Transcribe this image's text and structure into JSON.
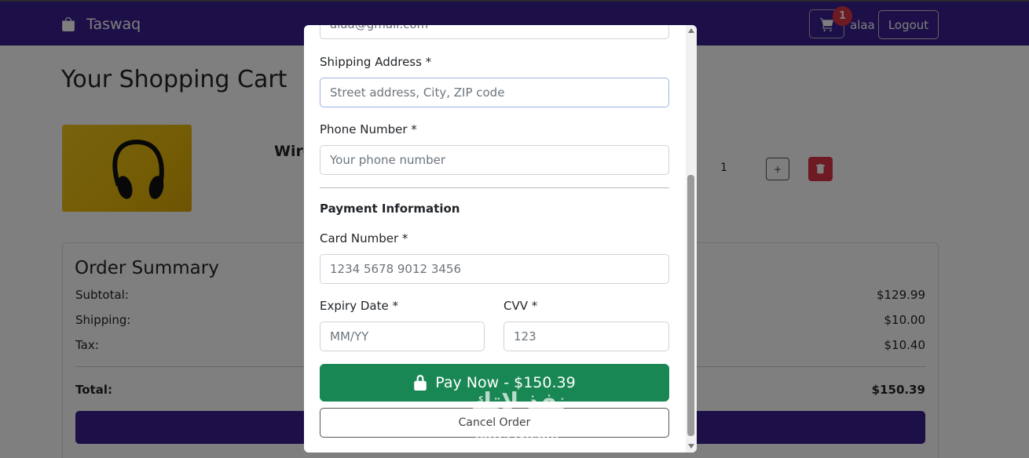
{
  "navbar": {
    "brand": "Taswaq",
    "cart_count": "1",
    "username": "alaa",
    "logout_label": "Logout"
  },
  "cart": {
    "title": "Your Shopping Cart",
    "item": {
      "name": "Wire",
      "quantity": "1",
      "plus_label": "+"
    }
  },
  "summary": {
    "title": "Order Summary",
    "rows": [
      {
        "label": "Subtotal:",
        "value": "$129.99"
      },
      {
        "label": "Shipping:",
        "value": "$10.00"
      },
      {
        "label": "Tax:",
        "value": "$10.40"
      }
    ],
    "total_label": "Total:",
    "total_value": "$150.39"
  },
  "modal": {
    "email_value": "alaa@gmail.com",
    "shipping_label": "Shipping Address *",
    "shipping_placeholder": "Street address, City, ZIP code",
    "phone_label": "Phone Number *",
    "phone_placeholder": "Your phone number",
    "payment_heading": "Payment Information",
    "card_label": "Card Number *",
    "card_placeholder": "1234 5678 9012 3456",
    "expiry_label": "Expiry Date *",
    "expiry_placeholder": "MM/YY",
    "cvv_label": "CVV *",
    "cvv_placeholder": "123",
    "pay_label": "Pay Now - $150.39",
    "cancel_label": "Cancel Order"
  },
  "watermark": {
    "text": "نفذ لاتك",
    "sub": "nafezly.com"
  },
  "colors": {
    "navbar": "#3b1f8f",
    "pay_button": "#198754",
    "danger": "#dc3545"
  }
}
